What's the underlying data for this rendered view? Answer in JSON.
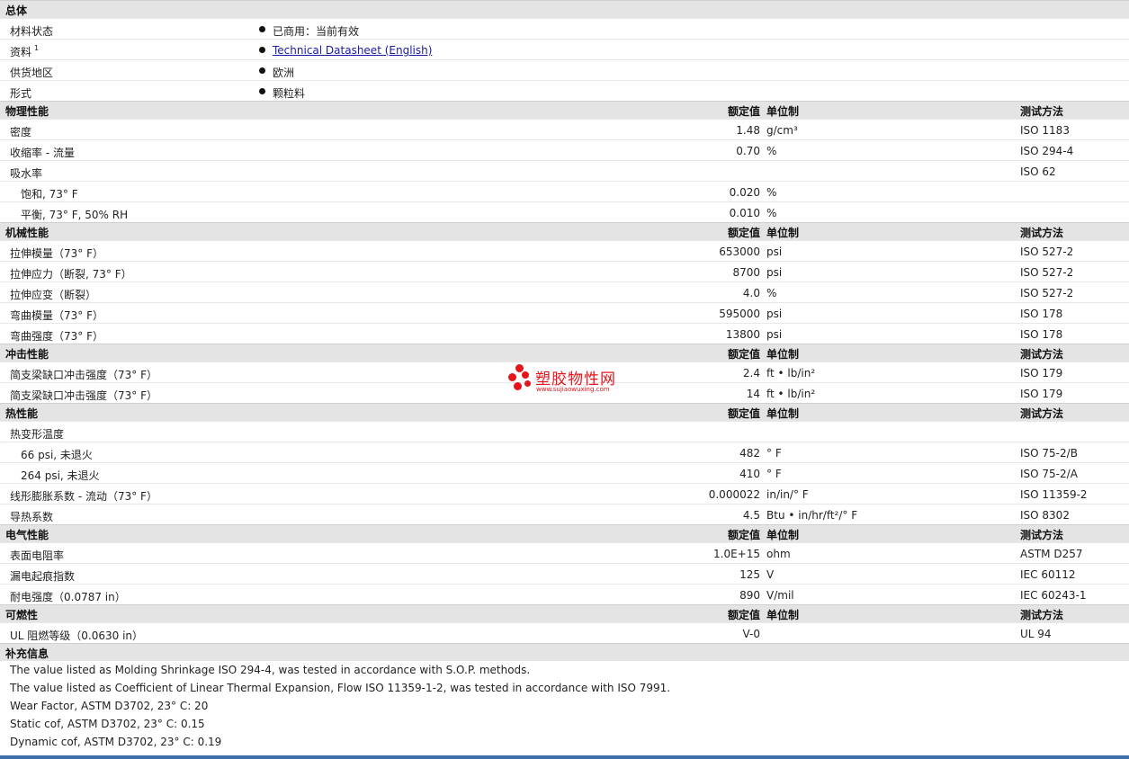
{
  "general": {
    "title": "总体",
    "rows": [
      {
        "label": "材料状态",
        "value": "已商用：当前有效"
      },
      {
        "label": "资料",
        "sup": "1",
        "value": "Technical Datasheet (English)"
      },
      {
        "label": "供货地区",
        "value": "欧洲"
      },
      {
        "label": "形式",
        "value": "颗粒料"
      }
    ]
  },
  "headers": {
    "value": "额定值",
    "unit": "单位制",
    "method": "测试方法"
  },
  "physical": {
    "title": "物理性能",
    "rows": [
      {
        "label": "密度",
        "value": "1.48",
        "unit": "g/cm³",
        "method": "ISO 1183"
      },
      {
        "label": "收缩率  - 流量",
        "value": "0.70",
        "unit": "%",
        "method": "ISO 294-4"
      },
      {
        "label": "吸水率",
        "value": "",
        "unit": "",
        "method": "ISO 62"
      },
      {
        "label": "饱和, 73°  F",
        "value": "0.020",
        "unit": "%",
        "method": ""
      },
      {
        "label": "平衡, 73°  F, 50% RH",
        "value": "0.010",
        "unit": "%",
        "method": ""
      }
    ]
  },
  "mechanical": {
    "title": "机械性能",
    "rows": [
      {
        "label": "拉伸模量（73°  F）",
        "value": "653000",
        "unit": "psi",
        "method": "ISO 527-2"
      },
      {
        "label": "拉伸应力（断裂, 73°  F）",
        "value": "8700",
        "unit": "psi",
        "method": "ISO 527-2"
      },
      {
        "label": "拉伸应变（断裂）",
        "value": "4.0",
        "unit": "%",
        "method": "ISO 527-2"
      },
      {
        "label": "弯曲模量（73°  F）",
        "value": "595000",
        "unit": "psi",
        "method": "ISO 178"
      },
      {
        "label": "弯曲强度（73°  F）",
        "value": "13800",
        "unit": "psi",
        "method": "ISO 178"
      }
    ]
  },
  "impact": {
    "title": "冲击性能",
    "rows": [
      {
        "label": "简支梁缺口冲击强度（73°  F）",
        "value": "2.4",
        "unit": "ft • lb/in²",
        "method": "ISO 179"
      },
      {
        "label": "简支梁缺口冲击强度（73°  F）",
        "value": "14",
        "unit": "ft • lb/in²",
        "method": "ISO 179"
      }
    ]
  },
  "thermal": {
    "title": "热性能",
    "rows": [
      {
        "label": "热变形温度",
        "value": "",
        "unit": "",
        "method": ""
      },
      {
        "label": "66 psi, 未退火",
        "value": "482",
        "unit": "°  F",
        "method": "ISO 75-2/B"
      },
      {
        "label": "264 psi, 未退火",
        "value": "410",
        "unit": "°  F",
        "method": "ISO 75-2/A"
      },
      {
        "label": "线形膨胀系数  - 流动（73°  F）",
        "value": "0.000022",
        "unit": "in/in/°  F",
        "method": "ISO 11359-2"
      },
      {
        "label": "导热系数",
        "value": "4.5",
        "unit": "Btu • in/hr/ft²/°  F",
        "method": "ISO 8302"
      }
    ]
  },
  "electrical": {
    "title": "电气性能",
    "rows": [
      {
        "label": "表面电阻率",
        "value": "1.0E+15",
        "unit": "ohm",
        "method": "ASTM D257"
      },
      {
        "label": "漏电起痕指数",
        "value": "125",
        "unit": "V",
        "method": "IEC 60112"
      },
      {
        "label": "耐电强度（0.0787 in）",
        "value": "890",
        "unit": "V/mil",
        "method": "IEC 60243-1"
      }
    ]
  },
  "flammability": {
    "title": "可燃性",
    "rows": [
      {
        "label": "UL 阻燃等级（0.0630 in）",
        "value": "V-0",
        "unit": "",
        "method": "UL 94"
      }
    ]
  },
  "notes": {
    "title": "补充信息",
    "lines": [
      "The value listed as Molding Shrinkage ISO 294-4, was tested in accordance with S.O.P. methods.",
      "The value listed as Coefficient of Linear Thermal Expansion, Flow ISO 11359-1-2, was tested in accordance with ISO 7991.",
      "Wear Factor, ASTM D3702, 23°  C: 20",
      "Static cof, ASTM D3702, 23°  C: 0.15",
      "Dynamic cof, ASTM D3702, 23°  C: 0.19"
    ]
  },
  "watermark": {
    "text": "塑胶物性网",
    "sub": "www.sujiaowuxing.com",
    "color": "#e8141c"
  }
}
